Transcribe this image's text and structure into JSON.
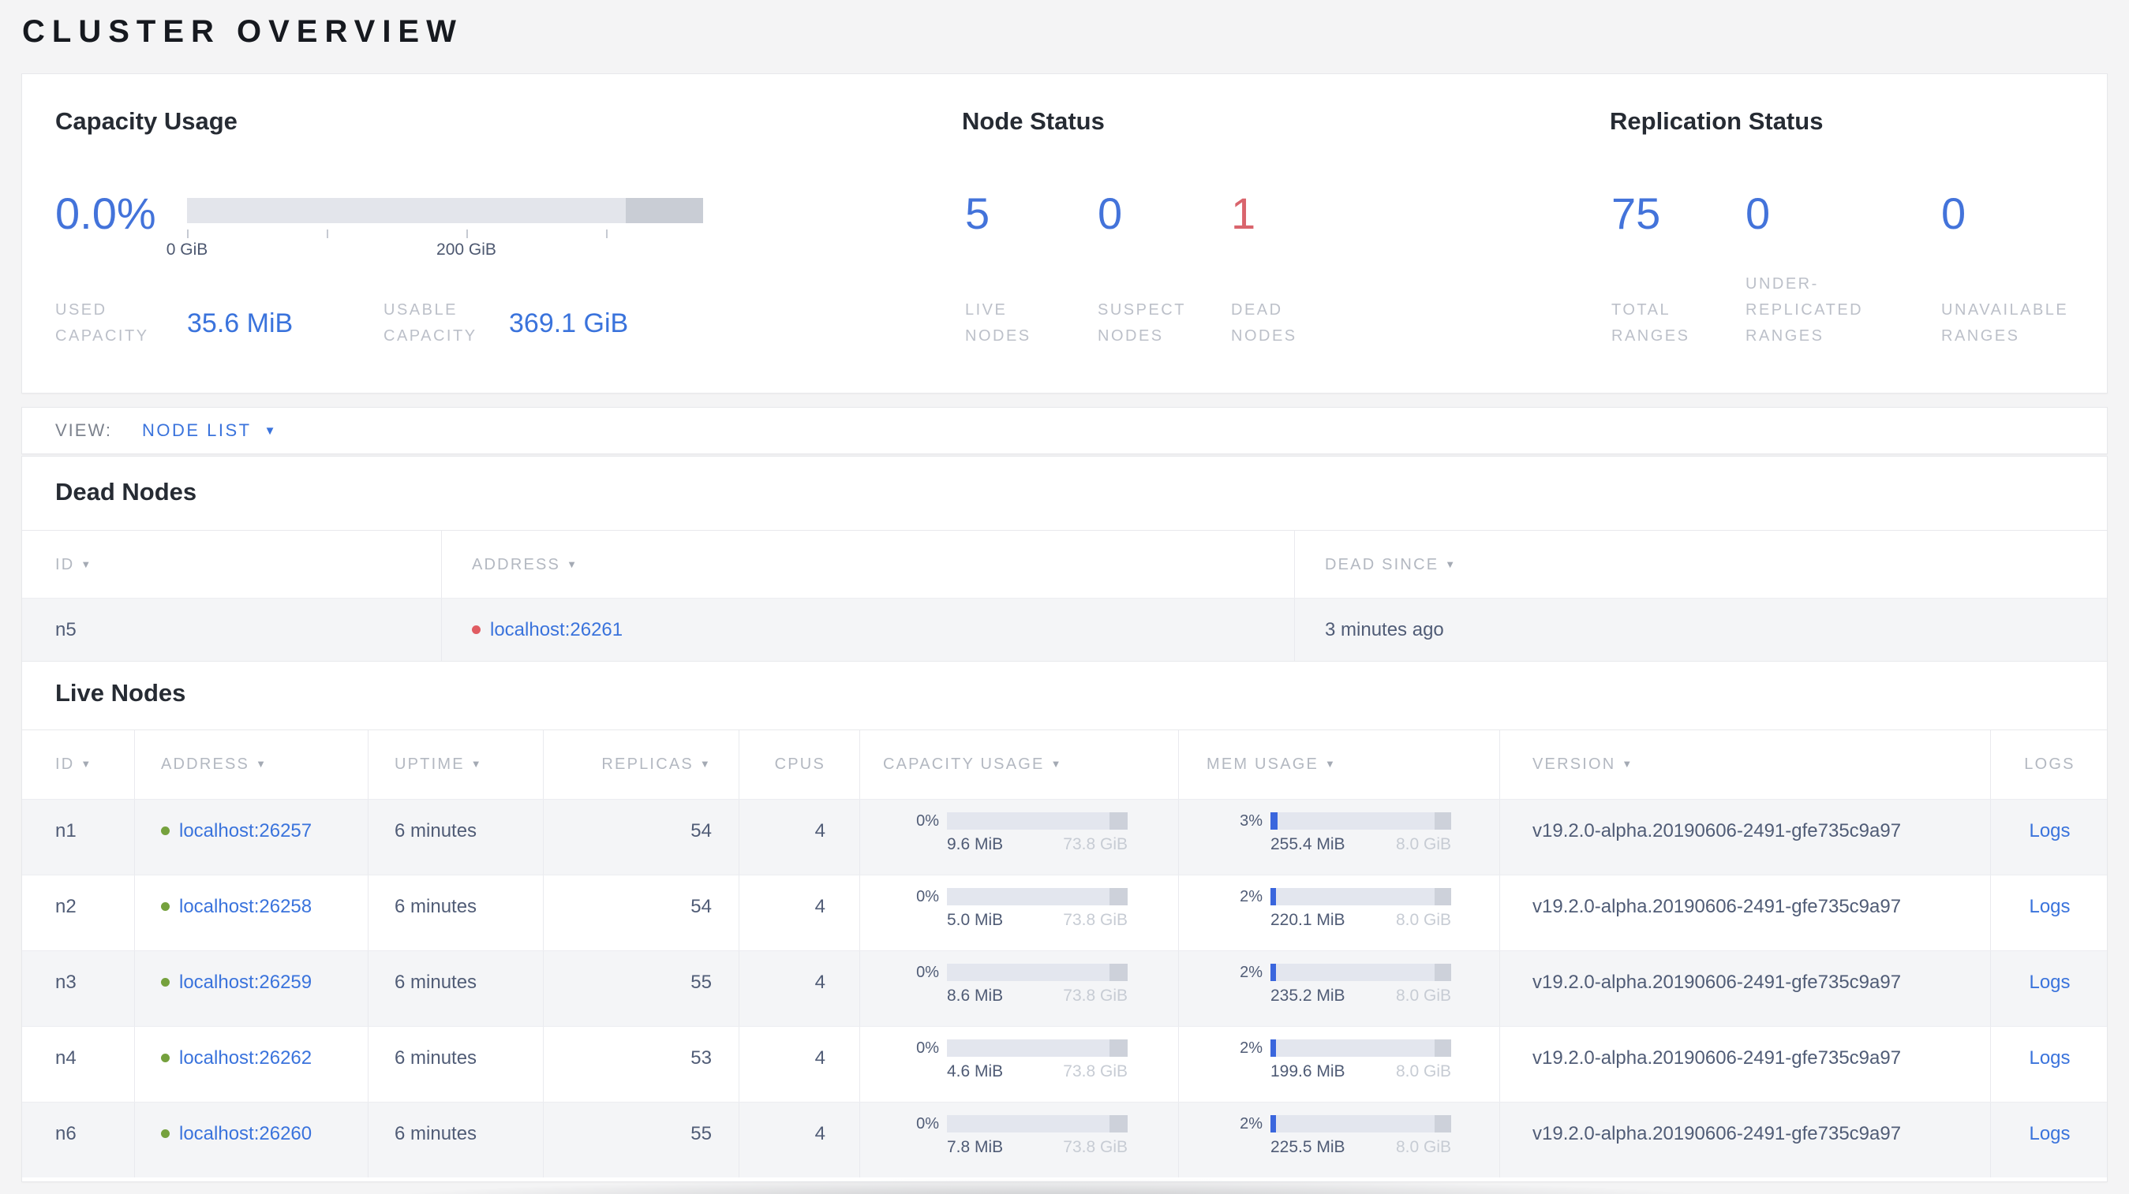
{
  "page": {
    "title": "CLUSTER OVERVIEW"
  },
  "icons": {
    "sort_desc": "▼",
    "dropdown_caret": "▼"
  },
  "colors": {
    "accent_blue": "#3a73dc",
    "status_red": "#d9646c",
    "status_green": "#75a13d"
  },
  "summary": {
    "capacity": {
      "heading": "Capacity Usage",
      "percent": "0.0%",
      "bar": {
        "used_fraction": 0,
        "reserved_fraction": 0.15
      },
      "tick_labels": [
        "0 GiB",
        "200 GiB"
      ],
      "used_label": "USED CAPACITY",
      "used_value": "35.6 MiB",
      "usable_label": "USABLE CAPACITY",
      "usable_value": "369.1 GiB"
    },
    "nodes": {
      "heading": "Node Status",
      "live": {
        "value": "5",
        "label": "LIVE NODES"
      },
      "suspect": {
        "value": "0",
        "label": "SUSPECT NODES"
      },
      "dead": {
        "value": "1",
        "label": "DEAD NODES"
      }
    },
    "replication": {
      "heading": "Replication Status",
      "total": {
        "value": "75",
        "label": "TOTAL RANGES"
      },
      "under": {
        "value": "0",
        "label": "UNDER-REPLICATED RANGES"
      },
      "unavailable": {
        "value": "0",
        "label": "UNAVAILABLE RANGES"
      }
    }
  },
  "view_bar": {
    "label": "VIEW:",
    "selected": "NODE LIST"
  },
  "dead_nodes": {
    "heading": "Dead Nodes",
    "columns": [
      "ID",
      "ADDRESS",
      "DEAD SINCE"
    ],
    "rows": [
      {
        "id": "n5",
        "address": "localhost:26261",
        "dead_since": "3 minutes ago"
      }
    ]
  },
  "live_nodes": {
    "heading": "Live Nodes",
    "columns": [
      "ID",
      "ADDRESS",
      "UPTIME",
      "REPLICAS",
      "CPUS",
      "CAPACITY USAGE",
      "MEM USAGE",
      "VERSION",
      "LOGS"
    ],
    "bar_reserved": {
      "capacity": 0.1,
      "mem": 0.09
    },
    "logs_label": "Logs",
    "rows": [
      {
        "id": "n1",
        "address": "localhost:26257",
        "uptime": "6 minutes",
        "replicas": "54",
        "cpus": "4",
        "capacity": {
          "percent": "0%",
          "used": "9.6 MiB",
          "total": "73.8 GiB",
          "fill": 0
        },
        "mem": {
          "percent": "3%",
          "used": "255.4 MiB",
          "total": "8.0 GiB",
          "fill": 0.04
        },
        "version": "v19.2.0-alpha.20190606-2491-gfe735c9a97"
      },
      {
        "id": "n2",
        "address": "localhost:26258",
        "uptime": "6 minutes",
        "replicas": "54",
        "cpus": "4",
        "capacity": {
          "percent": "0%",
          "used": "5.0 MiB",
          "total": "73.8 GiB",
          "fill": 0
        },
        "mem": {
          "percent": "2%",
          "used": "220.1 MiB",
          "total": "8.0 GiB",
          "fill": 0.03
        },
        "version": "v19.2.0-alpha.20190606-2491-gfe735c9a97"
      },
      {
        "id": "n3",
        "address": "localhost:26259",
        "uptime": "6 minutes",
        "replicas": "55",
        "cpus": "4",
        "capacity": {
          "percent": "0%",
          "used": "8.6 MiB",
          "total": "73.8 GiB",
          "fill": 0
        },
        "mem": {
          "percent": "2%",
          "used": "235.2 MiB",
          "total": "8.0 GiB",
          "fill": 0.03
        },
        "version": "v19.2.0-alpha.20190606-2491-gfe735c9a97"
      },
      {
        "id": "n4",
        "address": "localhost:26262",
        "uptime": "6 minutes",
        "replicas": "53",
        "cpus": "4",
        "capacity": {
          "percent": "0%",
          "used": "4.6 MiB",
          "total": "73.8 GiB",
          "fill": 0
        },
        "mem": {
          "percent": "2%",
          "used": "199.6 MiB",
          "total": "8.0 GiB",
          "fill": 0.03
        },
        "version": "v19.2.0-alpha.20190606-2491-gfe735c9a97"
      },
      {
        "id": "n6",
        "address": "localhost:26260",
        "uptime": "6 minutes",
        "replicas": "55",
        "cpus": "4",
        "capacity": {
          "percent": "0%",
          "used": "7.8 MiB",
          "total": "73.8 GiB",
          "fill": 0
        },
        "mem": {
          "percent": "2%",
          "used": "225.5 MiB",
          "total": "8.0 GiB",
          "fill": 0.03
        },
        "version": "v19.2.0-alpha.20190606-2491-gfe735c9a97"
      }
    ]
  }
}
